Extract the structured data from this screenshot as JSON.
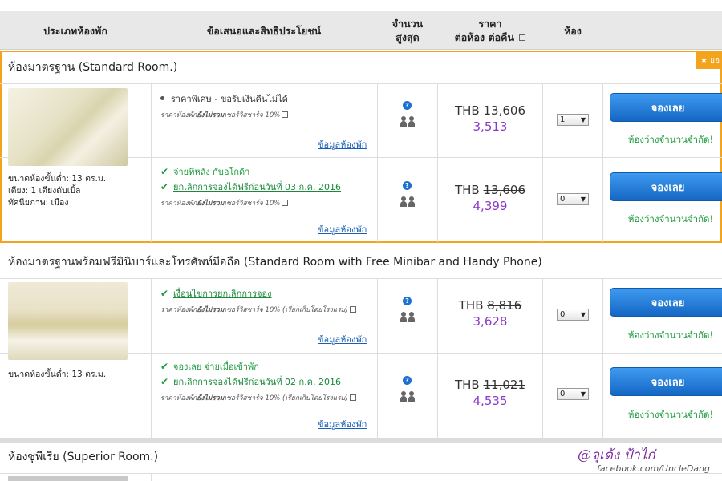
{
  "header": {
    "room_type": "ประเภทห้องพัก",
    "offers": "ข้อเสนอและสิทธิประโยชน์",
    "max_occupancy_l1": "จำนวน",
    "max_occupancy_l2": "สูงสุด",
    "price_l1": "ราคา",
    "price_l2": "ต่อห้อง ต่อคืน",
    "rooms": "ห้อง"
  },
  "badge": "★ ยอ",
  "common": {
    "currency": "THB",
    "book_label": "จองเลย",
    "more_info": "ข้อมูลห้องพัก",
    "limited": "ห้องว่างจำนวนจำกัด!",
    "note_prefix": "ราคาห้องพัก",
    "note_bold": "ยังไม่รวม",
    "note_suffix": " เซอร์วิสชาร์จ 10%",
    "note_hotel_suffix": " เซอร์วิสชาร์จ 10% (เรียกเก็บโดยโรงแรม)"
  },
  "rooms": [
    {
      "title": "ห้องมาตรฐาน (Standard Room.)",
      "info": [
        "ขนาดห้องขั้นต่ำ: 13 ตร.ม.",
        "เตียง: 1 เตียงดับเบิ้ล",
        "ทัศนียภาพ: เมือง"
      ],
      "offers": [
        {
          "lines": [
            {
              "kind": "bullet",
              "text": "ราคาพิเศษ - ขอรับเงินคืนไม่ได้"
            }
          ],
          "old_price": "13,606",
          "new_price": "3,513",
          "rooms_selected": "1"
        },
        {
          "lines": [
            {
              "kind": "check",
              "text": "จ่ายทีหลัง กับอโกด้า"
            },
            {
              "kind": "check-link",
              "text": "ยกเลิกการจองได้ฟรีก่อนวันที่ 03 ก.ค. 2016"
            }
          ],
          "old_price": "13,606",
          "new_price": "4,399",
          "rooms_selected": "0"
        }
      ]
    },
    {
      "title": "ห้องมาตรฐานพร้อมฟรีมินิบาร์และโทรศัพท์มือถือ (Standard Room with Free Minibar and Handy Phone)",
      "info": [
        "ขนาดห้องขั้นต่ำ: 13 ตร.ม."
      ],
      "offers": [
        {
          "lines": [
            {
              "kind": "check-link",
              "text": "เงื่อนไขการยกเลิกการจอง"
            }
          ],
          "old_price": "8,816",
          "new_price": "3,628",
          "rooms_selected": "0"
        },
        {
          "lines": [
            {
              "kind": "check",
              "text": "จองเลย จ่ายเมื่อเข้าพัก"
            },
            {
              "kind": "check-link",
              "text": "ยกเลิกการจองได้ฟรีก่อนวันที่ 02 ก.ค. 2016"
            }
          ],
          "old_price": "11,021",
          "new_price": "4,535",
          "rooms_selected": "0"
        }
      ]
    },
    {
      "title": "ห้องซูพีเรีย (Superior Room.)"
    }
  ],
  "watermark": {
    "name": "@จุเด้ง ป้าไก่",
    "url": "facebook.com/UncleDang"
  }
}
